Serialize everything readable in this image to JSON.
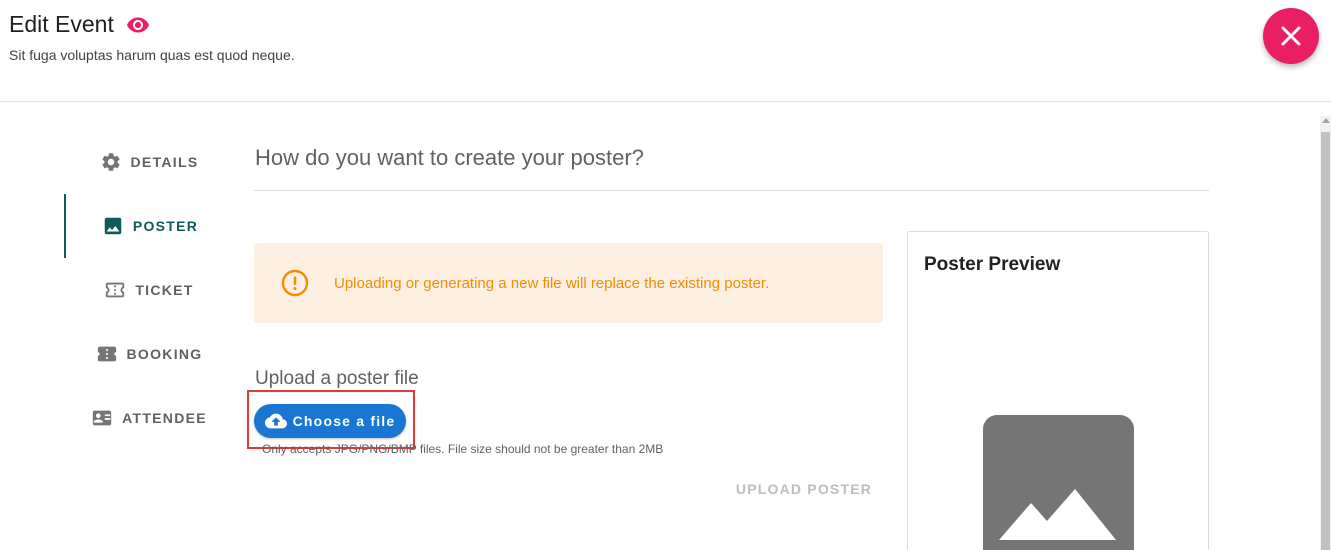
{
  "header": {
    "title": "Edit Event",
    "subtitle": "Sit fuga voluptas harum quas est quod neque."
  },
  "nav": {
    "items": [
      {
        "label": "DETAILS",
        "icon": "gear-icon",
        "active": false
      },
      {
        "label": "POSTER",
        "icon": "image-icon",
        "active": true
      },
      {
        "label": "TICKET",
        "icon": "ticket-icon",
        "active": false
      },
      {
        "label": "BOOKING",
        "icon": "booking-icon",
        "active": false
      },
      {
        "label": "ATTENDEE",
        "icon": "badge-icon",
        "active": false
      }
    ]
  },
  "main": {
    "heading": "How do you want to create your poster?",
    "alert_text": "Uploading or generating a new file will replace the existing poster.",
    "upload_heading": "Upload a poster file",
    "choose_label": "Choose a file",
    "hint": "Only accepts JPG/PNG/BMP files. File size should not be greater than 2MB",
    "upload_label": "UPLOAD POSTER"
  },
  "preview": {
    "title": "Poster Preview"
  },
  "colors": {
    "accent_pink": "#e91e63",
    "primary_blue": "#1976d2",
    "active_teal": "#0f5a5a",
    "warning_orange": "#f28c00",
    "warning_bg": "#fdf0e3",
    "highlight_red": "#e53935"
  }
}
